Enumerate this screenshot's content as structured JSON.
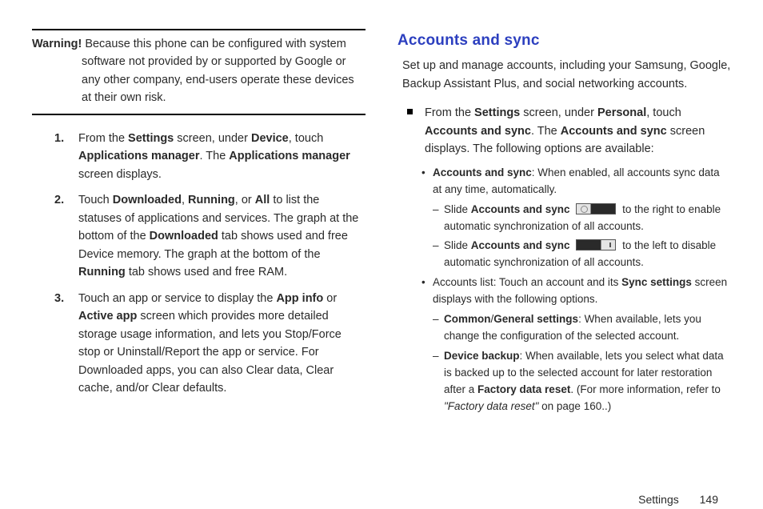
{
  "left": {
    "warning_label": "Warning!",
    "warning_line1": " Because this phone can be configured with system",
    "warning_rest": "software not provided by or supported by Google or any other company, end-users operate these devices at their own risk.",
    "s1a": "From the ",
    "s1b": "Settings",
    "s1c": " screen, under ",
    "s1d": "Device",
    "s1e": ", touch ",
    "s1f": "Applications manager",
    "s1g": ". The ",
    "s1h": "Applications manager",
    "s1i": " screen displays.",
    "s2a": "Touch ",
    "s2b": "Downloaded",
    "s2c": ", ",
    "s2d": "Running",
    "s2e": ", or ",
    "s2f": "All",
    "s2g": " to list the statuses of applications and services. The graph at the bottom of the ",
    "s2h": "Downloaded",
    "s2i": " tab shows used and free Device memory. The graph at the bottom of the ",
    "s2j": "Running",
    "s2k": " tab shows used and free RAM.",
    "s3a": "Touch an app or service to display the ",
    "s3b": "App info",
    "s3c": " or ",
    "s3d": "Active app",
    "s3e": " screen which provides more detailed storage usage information, and lets you Stop/Force stop or Uninstall/Report the app or service. For Downloaded apps, you can also Clear data, Clear cache, and/or Clear defaults."
  },
  "right": {
    "heading": "Accounts and sync",
    "intro": "Set up and manage accounts, including your Samsung, Google, Backup Assistant Plus, and social networking accounts.",
    "sq_a": "From the ",
    "sq_b": "Settings",
    "sq_c": " screen, under ",
    "sq_d": "Personal",
    "sq_e": ", touch ",
    "sq_f": "Accounts and sync",
    "sq_g": ". The ",
    "sq_h": "Accounts and sync",
    "sq_i": " screen displays. The following options are available:",
    "b1a": "Accounts and sync",
    "b1b": ": When enabled, all accounts sync data at any time, automatically.",
    "d1a": "Slide ",
    "d1b": "Accounts and sync",
    "d1c": " to the right to enable automatic synchronization of all accounts.",
    "d2a": "Slide ",
    "d2b": "Accounts and sync",
    "d2c": " to the left to disable automatic synchronization of all accounts.",
    "b2a": "Accounts list: Touch an account and its ",
    "b2b": "Sync settings",
    "b2c": " screen displays with the following options.",
    "d3a": "Common",
    "d3slash": "/",
    "d3b": "General settings",
    "d3c": ": When available, lets you change the configuration of the selected account.",
    "d4a": "Device backup",
    "d4b": ": When available, lets you select what data is backed up to the selected account for later restoration after a ",
    "d4c": "Factory data reset",
    "d4d": ". (For more information, refer to ",
    "d4e": "\"Factory data reset\"",
    "d4f": " on page 160..)"
  },
  "footer": {
    "section": "Settings",
    "page": "149"
  }
}
